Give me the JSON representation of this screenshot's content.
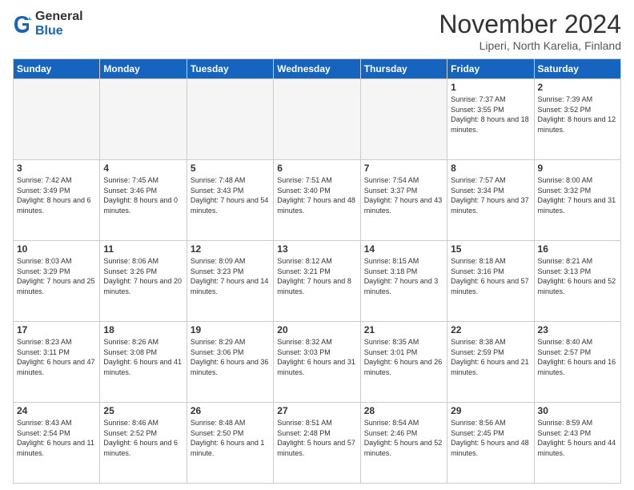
{
  "logo": {
    "general": "General",
    "blue": "Blue"
  },
  "header": {
    "month": "November 2024",
    "location": "Liperi, North Karelia, Finland"
  },
  "weekdays": [
    "Sunday",
    "Monday",
    "Tuesday",
    "Wednesday",
    "Thursday",
    "Friday",
    "Saturday"
  ],
  "weeks": [
    [
      {
        "day": "",
        "info": ""
      },
      {
        "day": "",
        "info": ""
      },
      {
        "day": "",
        "info": ""
      },
      {
        "day": "",
        "info": ""
      },
      {
        "day": "",
        "info": ""
      },
      {
        "day": "1",
        "info": "Sunrise: 7:37 AM\nSunset: 3:55 PM\nDaylight: 8 hours\nand 18 minutes."
      },
      {
        "day": "2",
        "info": "Sunrise: 7:39 AM\nSunset: 3:52 PM\nDaylight: 8 hours\nand 12 minutes."
      }
    ],
    [
      {
        "day": "3",
        "info": "Sunrise: 7:42 AM\nSunset: 3:49 PM\nDaylight: 8 hours\nand 6 minutes."
      },
      {
        "day": "4",
        "info": "Sunrise: 7:45 AM\nSunset: 3:46 PM\nDaylight: 8 hours\nand 0 minutes."
      },
      {
        "day": "5",
        "info": "Sunrise: 7:48 AM\nSunset: 3:43 PM\nDaylight: 7 hours\nand 54 minutes."
      },
      {
        "day": "6",
        "info": "Sunrise: 7:51 AM\nSunset: 3:40 PM\nDaylight: 7 hours\nand 48 minutes."
      },
      {
        "day": "7",
        "info": "Sunrise: 7:54 AM\nSunset: 3:37 PM\nDaylight: 7 hours\nand 43 minutes."
      },
      {
        "day": "8",
        "info": "Sunrise: 7:57 AM\nSunset: 3:34 PM\nDaylight: 7 hours\nand 37 minutes."
      },
      {
        "day": "9",
        "info": "Sunrise: 8:00 AM\nSunset: 3:32 PM\nDaylight: 7 hours\nand 31 minutes."
      }
    ],
    [
      {
        "day": "10",
        "info": "Sunrise: 8:03 AM\nSunset: 3:29 PM\nDaylight: 7 hours\nand 25 minutes."
      },
      {
        "day": "11",
        "info": "Sunrise: 8:06 AM\nSunset: 3:26 PM\nDaylight: 7 hours\nand 20 minutes."
      },
      {
        "day": "12",
        "info": "Sunrise: 8:09 AM\nSunset: 3:23 PM\nDaylight: 7 hours\nand 14 minutes."
      },
      {
        "day": "13",
        "info": "Sunrise: 8:12 AM\nSunset: 3:21 PM\nDaylight: 7 hours\nand 8 minutes."
      },
      {
        "day": "14",
        "info": "Sunrise: 8:15 AM\nSunset: 3:18 PM\nDaylight: 7 hours\nand 3 minutes."
      },
      {
        "day": "15",
        "info": "Sunrise: 8:18 AM\nSunset: 3:16 PM\nDaylight: 6 hours\nand 57 minutes."
      },
      {
        "day": "16",
        "info": "Sunrise: 8:21 AM\nSunset: 3:13 PM\nDaylight: 6 hours\nand 52 minutes."
      }
    ],
    [
      {
        "day": "17",
        "info": "Sunrise: 8:23 AM\nSunset: 3:11 PM\nDaylight: 6 hours\nand 47 minutes."
      },
      {
        "day": "18",
        "info": "Sunrise: 8:26 AM\nSunset: 3:08 PM\nDaylight: 6 hours\nand 41 minutes."
      },
      {
        "day": "19",
        "info": "Sunrise: 8:29 AM\nSunset: 3:06 PM\nDaylight: 6 hours\nand 36 minutes."
      },
      {
        "day": "20",
        "info": "Sunrise: 8:32 AM\nSunset: 3:03 PM\nDaylight: 6 hours\nand 31 minutes."
      },
      {
        "day": "21",
        "info": "Sunrise: 8:35 AM\nSunset: 3:01 PM\nDaylight: 6 hours\nand 26 minutes."
      },
      {
        "day": "22",
        "info": "Sunrise: 8:38 AM\nSunset: 2:59 PM\nDaylight: 6 hours\nand 21 minutes."
      },
      {
        "day": "23",
        "info": "Sunrise: 8:40 AM\nSunset: 2:57 PM\nDaylight: 6 hours\nand 16 minutes."
      }
    ],
    [
      {
        "day": "24",
        "info": "Sunrise: 8:43 AM\nSunset: 2:54 PM\nDaylight: 6 hours\nand 11 minutes."
      },
      {
        "day": "25",
        "info": "Sunrise: 8:46 AM\nSunset: 2:52 PM\nDaylight: 6 hours\nand 6 minutes."
      },
      {
        "day": "26",
        "info": "Sunrise: 8:48 AM\nSunset: 2:50 PM\nDaylight: 6 hours\nand 1 minute."
      },
      {
        "day": "27",
        "info": "Sunrise: 8:51 AM\nSunset: 2:48 PM\nDaylight: 5 hours\nand 57 minutes."
      },
      {
        "day": "28",
        "info": "Sunrise: 8:54 AM\nSunset: 2:46 PM\nDaylight: 5 hours\nand 52 minutes."
      },
      {
        "day": "29",
        "info": "Sunrise: 8:56 AM\nSunset: 2:45 PM\nDaylight: 5 hours\nand 48 minutes."
      },
      {
        "day": "30",
        "info": "Sunrise: 8:59 AM\nSunset: 2:43 PM\nDaylight: 5 hours\nand 44 minutes."
      }
    ]
  ]
}
